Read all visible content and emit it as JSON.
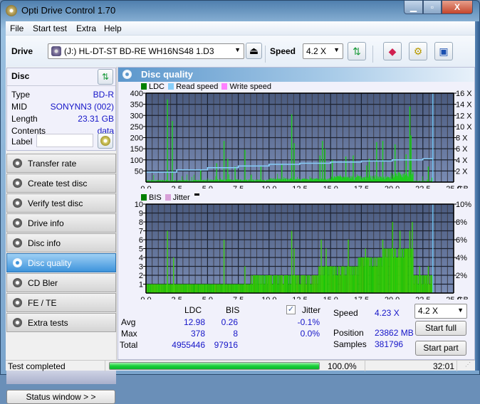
{
  "window": {
    "title": "Opti Drive Control 1.70",
    "min_label": "—",
    "max_label": "□",
    "close_label": "X"
  },
  "menu": [
    "File",
    "Start test",
    "Extra",
    "Help"
  ],
  "toolbar": {
    "drive_label": "Drive",
    "drive_value": "(J:)  HL-DT-ST BD-RE  WH16NS48 1.D3",
    "speed_label": "Speed",
    "speed_value": "4.2 X"
  },
  "disc": {
    "header": "Disc",
    "rows": [
      {
        "key": "Type",
        "value": "BD-R"
      },
      {
        "key": "MID",
        "value": "SONYNN3 (002)"
      },
      {
        "key": "Length",
        "value": "23.31 GB"
      },
      {
        "key": "Contents",
        "value": "data"
      }
    ],
    "label_key": "Label",
    "label_value": ""
  },
  "nav": [
    {
      "label": "Transfer rate",
      "active": false
    },
    {
      "label": "Create test disc",
      "active": false
    },
    {
      "label": "Verify test disc",
      "active": false
    },
    {
      "label": "Drive info",
      "active": false
    },
    {
      "label": "Disc info",
      "active": false
    },
    {
      "label": "Disc quality",
      "active": true
    },
    {
      "label": "CD Bler",
      "active": false
    },
    {
      "label": "FE / TE",
      "active": false
    },
    {
      "label": "Extra tests",
      "active": false
    }
  ],
  "status_window_label": "Status window > >",
  "panel_title": "Disc quality",
  "colors": {
    "ldc": "#008000",
    "read_speed": "#87cefa",
    "write_speed": "#ff80ff",
    "bis": "#008000",
    "jitter": "#d8a0d8",
    "plot_bg_top": "#4a5a7e",
    "plot_bg_bottom": "#7a8cb4",
    "bar": "#1ecc1e"
  },
  "chart_data": [
    {
      "type": "bar",
      "title": "LDC / Read speed",
      "legend": [
        "LDC",
        "Read speed",
        "Write speed"
      ],
      "x_unit": "GB",
      "xlim": [
        0,
        25
      ],
      "x_ticks": [
        "0.0",
        "2.5",
        "5.0",
        "7.5",
        "10.0",
        "12.5",
        "15.0",
        "17.5",
        "20.0",
        "22.5",
        "25.0"
      ],
      "ylim_left": [
        0,
        400
      ],
      "y_ticks_left": [
        "50",
        "100",
        "150",
        "200",
        "250",
        "300",
        "350",
        "400"
      ],
      "ylim_right": [
        0,
        16
      ],
      "y_ticks_right": [
        "2 X",
        "4 X",
        "6 X",
        "8 X",
        "10 X",
        "12 X",
        "14 X",
        "16 X"
      ],
      "ldc_baseline": [
        [
          0,
          8
        ],
        [
          5,
          10
        ],
        [
          10,
          14
        ],
        [
          15,
          22
        ],
        [
          20,
          35
        ],
        [
          21.5,
          40
        ],
        [
          21.7,
          5
        ],
        [
          23.4,
          5
        ]
      ],
      "ldc_spikes": [
        [
          1.7,
          372
        ],
        [
          2.1,
          275
        ],
        [
          4.4,
          55
        ],
        [
          5.7,
          85
        ],
        [
          6.3,
          185
        ],
        [
          6.6,
          105
        ],
        [
          7.2,
          70
        ],
        [
          8.0,
          145
        ],
        [
          9.3,
          70
        ],
        [
          11.0,
          80
        ],
        [
          11.8,
          305
        ],
        [
          12.0,
          175
        ],
        [
          14.1,
          120
        ],
        [
          14.3,
          185
        ],
        [
          14.5,
          150
        ],
        [
          15.1,
          100
        ],
        [
          16.2,
          115
        ],
        [
          16.8,
          120
        ],
        [
          17.9,
          75
        ],
        [
          18.1,
          105
        ],
        [
          18.7,
          180
        ],
        [
          19.2,
          185
        ],
        [
          20.2,
          170
        ],
        [
          21.1,
          125
        ],
        [
          21.4,
          340
        ],
        [
          21.5,
          210
        ],
        [
          22.9,
          70
        ],
        [
          23.2,
          20
        ]
      ],
      "read_speed": [
        [
          0,
          1.8
        ],
        [
          2.5,
          2.2
        ],
        [
          5,
          2.6
        ],
        [
          7.5,
          2.9
        ],
        [
          10,
          3.2
        ],
        [
          12.5,
          3.4
        ],
        [
          15,
          3.6
        ],
        [
          17.5,
          3.8
        ],
        [
          20,
          4.0
        ],
        [
          22.5,
          4.2
        ],
        [
          23.31,
          4.2
        ]
      ],
      "end_marker_gb": 23.31
    },
    {
      "type": "bar",
      "title": "BIS / Jitter",
      "legend": [
        "BIS",
        "Jitter"
      ],
      "x_unit": "GB",
      "xlim": [
        0,
        25
      ],
      "x_ticks": [
        "0.0",
        "2.5",
        "5.0",
        "7.5",
        "10.0",
        "12.5",
        "15.0",
        "17.5",
        "20.0",
        "22.5",
        "25.0"
      ],
      "ylim_left": [
        0,
        10
      ],
      "y_ticks_left": [
        "1",
        "2",
        "3",
        "4",
        "5",
        "6",
        "7",
        "8",
        "9",
        "10"
      ],
      "ylim_right": [
        0,
        10
      ],
      "y_ticks_right": [
        "2%",
        "4%",
        "6%",
        "8%",
        "10%"
      ],
      "bis_levels": [
        [
          0,
          1
        ],
        [
          7.5,
          1
        ],
        [
          8.5,
          2
        ],
        [
          12.5,
          2
        ],
        [
          14,
          3
        ],
        [
          16,
          3
        ],
        [
          17.2,
          4
        ],
        [
          19.2,
          5
        ],
        [
          21.6,
          5
        ],
        [
          21.7,
          2
        ],
        [
          23.4,
          2
        ]
      ],
      "bis_spikes": [
        [
          1.7,
          7
        ],
        [
          2.2,
          4
        ],
        [
          6.3,
          6
        ],
        [
          8.0,
          3
        ],
        [
          11.8,
          7
        ],
        [
          12.0,
          5
        ],
        [
          14.2,
          6
        ],
        [
          14.6,
          5
        ],
        [
          16.4,
          6
        ],
        [
          17.8,
          5
        ],
        [
          19.2,
          6
        ],
        [
          20.0,
          8
        ],
        [
          20.6,
          7
        ],
        [
          21.4,
          7
        ],
        [
          21.6,
          8
        ],
        [
          22.2,
          3
        ],
        [
          22.9,
          3
        ]
      ],
      "end_marker_gb": 23.31
    }
  ],
  "stats": {
    "col_ldc": "LDC",
    "col_bis": "BIS",
    "jitter_label": "Jitter",
    "jitter_checked": true,
    "rows": [
      {
        "label": "Avg",
        "ldc": "12.98",
        "bis": "0.26",
        "jitter": "-0.1%"
      },
      {
        "label": "Max",
        "ldc": "378",
        "bis": "8",
        "jitter": "0.0%"
      },
      {
        "label": "Total",
        "ldc": "4955446",
        "bis": "97916",
        "jitter": ""
      }
    ],
    "speed_label": "Speed",
    "speed_value": "4.23 X",
    "position_label": "Position",
    "position_value": "23862 MB",
    "samples_label": "Samples",
    "samples_value": "381796",
    "speed_select": "4.2 X",
    "start_full": "Start full",
    "start_part": "Start part"
  },
  "statusbar": {
    "text": "Test completed",
    "progress": 100.0,
    "progress_text": "100.0%",
    "time": "32:01"
  }
}
